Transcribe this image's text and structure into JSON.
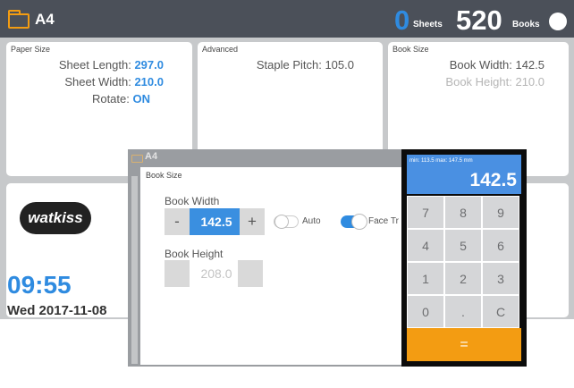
{
  "topbar": {
    "title": "A4",
    "sheets_count": "0",
    "sheets_label": "Sheets",
    "books_count": "520",
    "books_label": "Books"
  },
  "paper_size": {
    "label": "Paper Size",
    "sheet_length_label": "Sheet Length:",
    "sheet_length_value": "297.0",
    "sheet_width_label": "Sheet Width:",
    "sheet_width_value": "210.0",
    "rotate_label": "Rotate:",
    "rotate_value": "ON"
  },
  "advanced": {
    "label": "Advanced",
    "staple_pitch": "Staple Pitch: 105.0"
  },
  "book_size_card": {
    "label": "Book Size",
    "book_width": "Book Width: 142.5",
    "book_height": "Book Height: 210.0"
  },
  "brand": {
    "logo": "watkiss"
  },
  "clock": {
    "time": "09:55",
    "date": "Wed 2017-11-08"
  },
  "overlay": {
    "title": "A4"
  },
  "dialog": {
    "label": "Book Size",
    "book_width_label": "Book Width",
    "minus": "-",
    "width_value": "142.5",
    "plus": "+",
    "auto_label": "Auto",
    "auto_on": false,
    "face_trim_label": "Face Tr",
    "face_trim_on": true,
    "book_height_label": "Book Height",
    "height_value": "208.0"
  },
  "keypad": {
    "range": "min: 113.5  max: 147.5 mm",
    "value": "142.5",
    "keys": [
      "7",
      "8",
      "9",
      "4",
      "5",
      "6",
      "1",
      "2",
      "3",
      "0",
      ".",
      "C"
    ],
    "equals": "="
  },
  "colors": {
    "accent": "#2f8be0",
    "topbar": "#4b5059",
    "orange": "#f39c12",
    "keypad_display": "#4a90e2"
  }
}
